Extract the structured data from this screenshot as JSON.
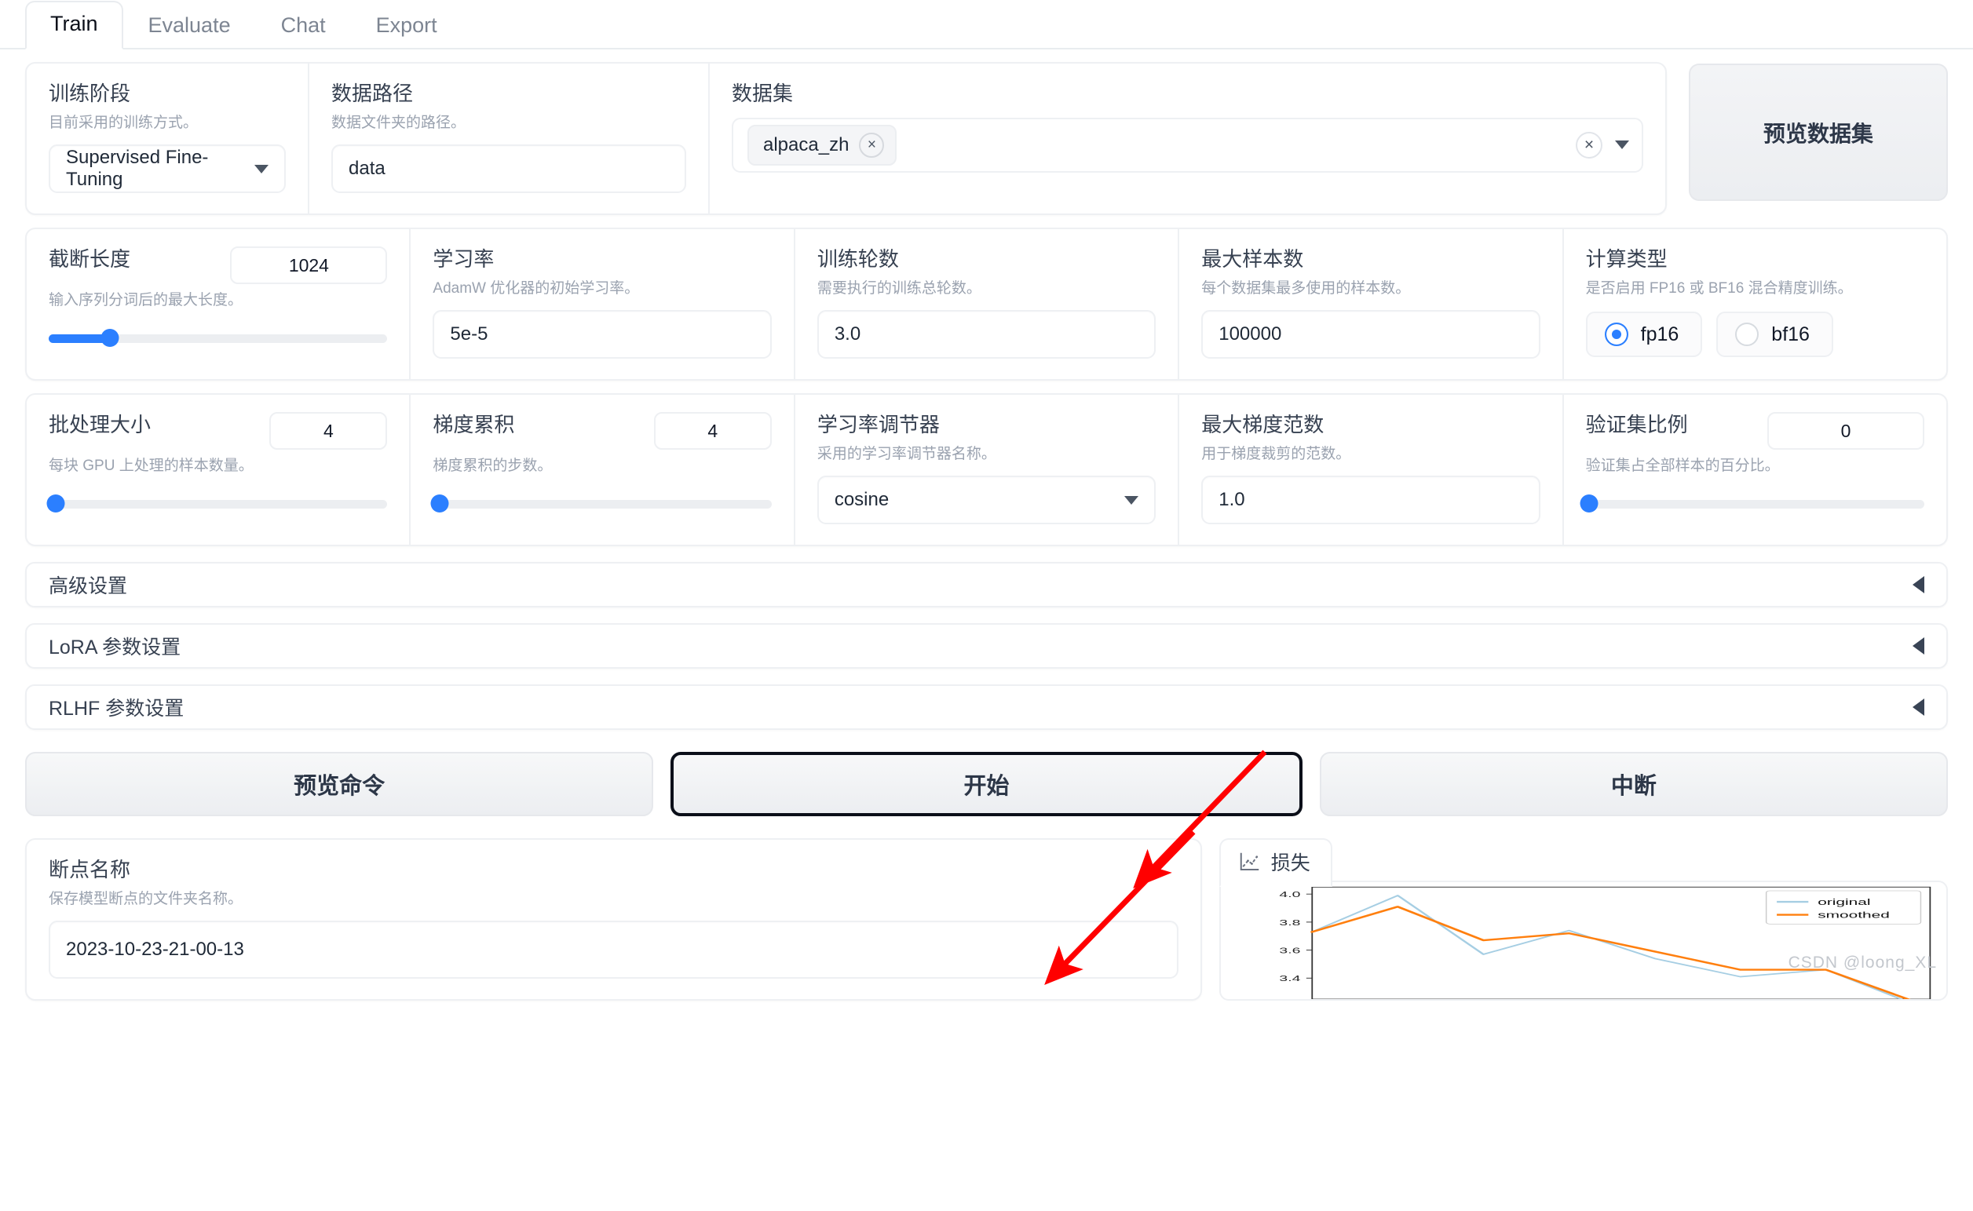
{
  "tabs": [
    {
      "label": "Train",
      "active": true
    },
    {
      "label": "Evaluate",
      "active": false
    },
    {
      "label": "Chat",
      "active": false
    },
    {
      "label": "Export",
      "active": false
    }
  ],
  "header": {
    "stage": {
      "label": "训练阶段",
      "desc": "目前采用的训练方式。",
      "value": "Supervised Fine-Tuning"
    },
    "data_path": {
      "label": "数据路径",
      "desc": "数据文件夹的路径。",
      "value": "data"
    },
    "dataset": {
      "label": "数据集",
      "chips": [
        "alpaca_zh"
      ],
      "chip_remove_icon": "×",
      "clear_icon": "×",
      "caret_icon": "▼"
    },
    "preview_button": "预览数据集"
  },
  "row2": {
    "cutoff_len": {
      "label": "截断长度",
      "desc": "输入序列分词后的最大长度。",
      "value": "1024",
      "slider_percent": 18
    },
    "learning_rate": {
      "label": "学习率",
      "desc": "AdamW 优化器的初始学习率。",
      "value": "5e-5"
    },
    "epochs": {
      "label": "训练轮数",
      "desc": "需要执行的训练总轮数。",
      "value": "3.0"
    },
    "max_samples": {
      "label": "最大样本数",
      "desc": "每个数据集最多使用的样本数。",
      "value": "100000"
    },
    "compute_type": {
      "label": "计算类型",
      "desc": "是否启用 FP16 或 BF16 混合精度训练。",
      "options": [
        {
          "label": "fp16",
          "selected": true
        },
        {
          "label": "bf16",
          "selected": false
        }
      ]
    }
  },
  "row3": {
    "batch_size": {
      "label": "批处理大小",
      "desc": "每块 GPU 上处理的样本数量。",
      "value": "4",
      "slider_percent": 2
    },
    "grad_accum": {
      "label": "梯度累积",
      "desc": "梯度累积的步数。",
      "value": "4",
      "slider_percent": 2
    },
    "lr_scheduler": {
      "label": "学习率调节器",
      "desc": "采用的学习率调节器名称。",
      "value": "cosine"
    },
    "max_grad_norm": {
      "label": "最大梯度范数",
      "desc": "用于梯度裁剪的范数。",
      "value": "1.0"
    },
    "val_size": {
      "label": "验证集比例",
      "desc": "验证集占全部样本的百分比。",
      "value": "0",
      "slider_percent": 1
    }
  },
  "accordions": [
    {
      "title": "高级设置",
      "icon": "collapse-arrow-icon"
    },
    {
      "title": "LoRA 参数设置",
      "icon": "collapse-arrow-icon"
    },
    {
      "title": "RLHF 参数设置",
      "icon": "collapse-arrow-icon"
    }
  ],
  "actions": {
    "preview_command": "预览命令",
    "start": "开始",
    "abort": "中断"
  },
  "bottom": {
    "checkpoint": {
      "label": "断点名称",
      "desc": "保存模型断点的文件夹名称。",
      "value": "2023-10-23-21-00-13"
    },
    "loss_tab": "损失",
    "watermark": "CSDN @loong_XL"
  },
  "chart_data": {
    "type": "line",
    "title": "损失",
    "xlabel": "",
    "ylabel": "",
    "ylim": [
      3.25,
      4.05
    ],
    "yticks": [
      3.4,
      3.6,
      3.8,
      4.0
    ],
    "grid": false,
    "legend_position": "upper right",
    "x": [
      0,
      1,
      2,
      3,
      4,
      5,
      6,
      7
    ],
    "series": [
      {
        "name": "original",
        "color": "#a6cee3",
        "values": [
          3.73,
          3.99,
          3.57,
          3.74,
          3.54,
          3.41,
          3.46,
          3.22
        ]
      },
      {
        "name": "smoothed",
        "color": "#ff7f0e",
        "values": [
          3.73,
          3.91,
          3.67,
          3.72,
          3.59,
          3.46,
          3.46,
          3.24
        ]
      }
    ]
  },
  "annotation": {
    "arrow_color": "#ff0000",
    "name": "red-annotation-arrow"
  }
}
